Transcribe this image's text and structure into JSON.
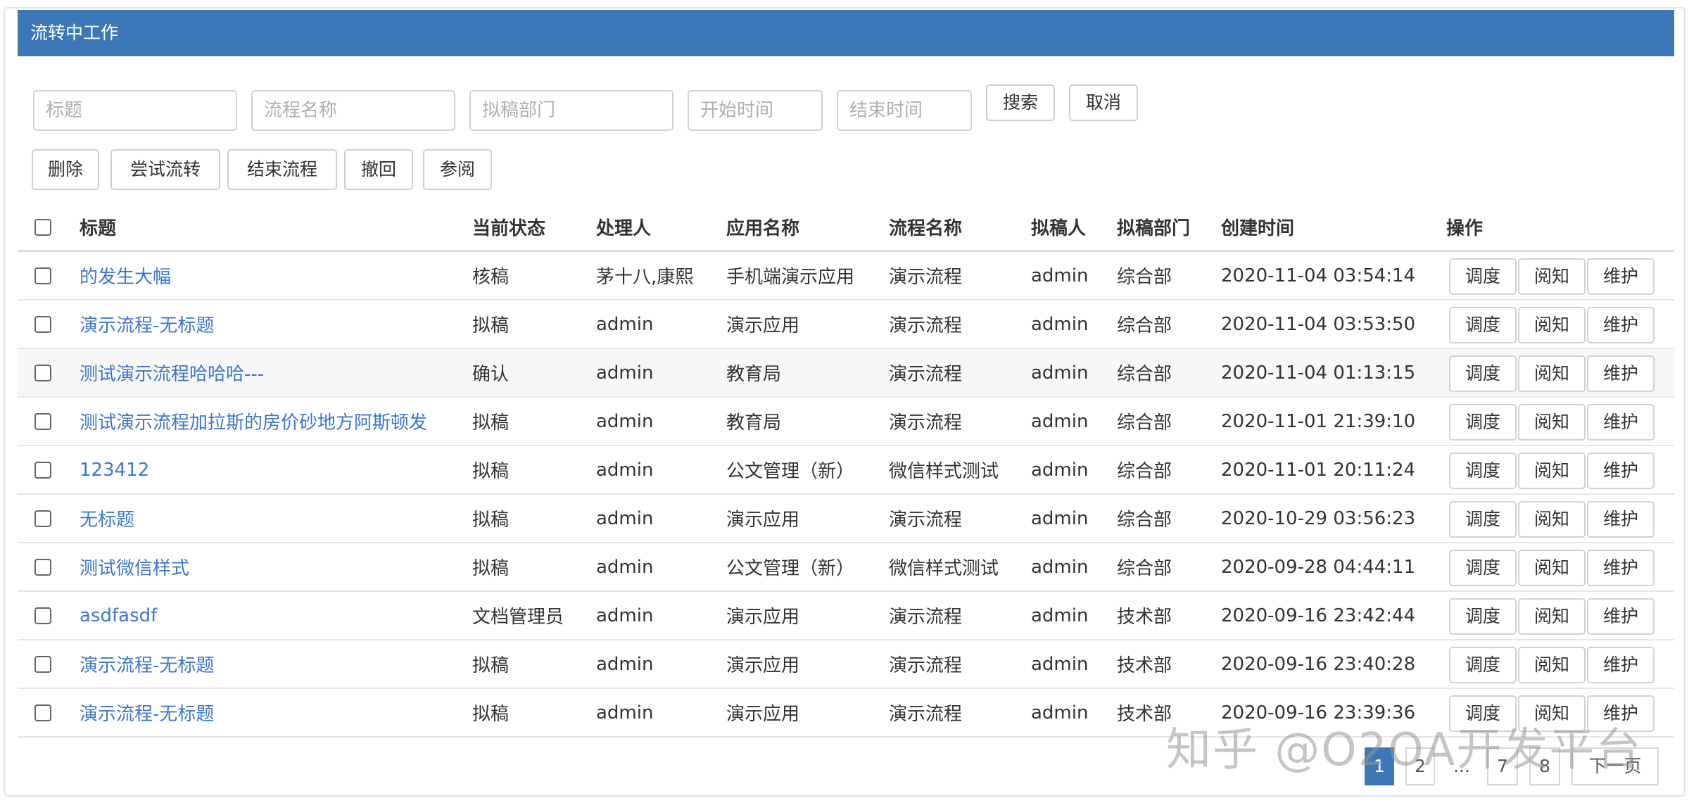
{
  "panel": {
    "title": "流转中工作"
  },
  "search": {
    "title_placeholder": "标题",
    "process_placeholder": "流程名称",
    "dept_placeholder": "拟稿部门",
    "start_placeholder": "开始时间",
    "end_placeholder": "结束时间",
    "search_label": "搜索",
    "cancel_label": "取消"
  },
  "actions": {
    "delete": "删除",
    "try_flow": "尝试流转",
    "end_flow": "结束流程",
    "withdraw": "撤回",
    "review": "参阅"
  },
  "table": {
    "headers": {
      "title": "标题",
      "status": "当前状态",
      "handler": "处理人",
      "app": "应用名称",
      "process": "流程名称",
      "drafter": "拟稿人",
      "dept": "拟稿部门",
      "created": "创建时间",
      "ops": "操作"
    },
    "op_labels": {
      "dispatch": "调度",
      "read": "阅知",
      "maintain": "维护"
    },
    "rows": [
      {
        "title": "的发生大幅",
        "status": "核稿",
        "handler": "茅十八,康熙",
        "app": "手机端演示应用",
        "process": "演示流程",
        "drafter": "admin",
        "dept": "综合部",
        "created": "2020-11-04 03:54:14"
      },
      {
        "title": "演示流程-无标题",
        "status": "拟稿",
        "handler": "admin",
        "app": "演示应用",
        "process": "演示流程",
        "drafter": "admin",
        "dept": "综合部",
        "created": "2020-11-04 03:53:50"
      },
      {
        "title": "测试演示流程哈哈哈---",
        "status": "确认",
        "handler": "admin",
        "app": "教育局",
        "process": "演示流程",
        "drafter": "admin",
        "dept": "综合部",
        "created": "2020-11-04 01:13:15"
      },
      {
        "title": "测试演示流程加拉斯的房价砂地方阿斯顿发",
        "status": "拟稿",
        "handler": "admin",
        "app": "教育局",
        "process": "演示流程",
        "drafter": "admin",
        "dept": "综合部",
        "created": "2020-11-01 21:39:10"
      },
      {
        "title": "123412",
        "status": "拟稿",
        "handler": "admin",
        "app": "公文管理（新）",
        "process": "微信样式测试",
        "drafter": "admin",
        "dept": "综合部",
        "created": "2020-11-01 20:11:24"
      },
      {
        "title": "无标题",
        "status": "拟稿",
        "handler": "admin",
        "app": "演示应用",
        "process": "演示流程",
        "drafter": "admin",
        "dept": "综合部",
        "created": "2020-10-29 03:56:23"
      },
      {
        "title": "测试微信样式",
        "status": "拟稿",
        "handler": "admin",
        "app": "公文管理（新）",
        "process": "微信样式测试",
        "drafter": "admin",
        "dept": "综合部",
        "created": "2020-09-28 04:44:11"
      },
      {
        "title": "asdfasdf",
        "status": "文档管理员",
        "handler": "admin",
        "app": "演示应用",
        "process": "演示流程",
        "drafter": "admin",
        "dept": "技术部",
        "created": "2020-09-16 23:42:44"
      },
      {
        "title": "演示流程-无标题",
        "status": "拟稿",
        "handler": "admin",
        "app": "演示应用",
        "process": "演示流程",
        "drafter": "admin",
        "dept": "技术部",
        "created": "2020-09-16 23:40:28"
      },
      {
        "title": "演示流程-无标题",
        "status": "拟稿",
        "handler": "admin",
        "app": "演示应用",
        "process": "演示流程",
        "drafter": "admin",
        "dept": "技术部",
        "created": "2020-09-16 23:39:36"
      }
    ]
  },
  "pager": {
    "pages": [
      "1",
      "2",
      "...",
      "7",
      "8"
    ],
    "current": "1",
    "next_label": "下一页"
  },
  "watermark": {
    "text": "知乎 @O2OA开发平台"
  }
}
